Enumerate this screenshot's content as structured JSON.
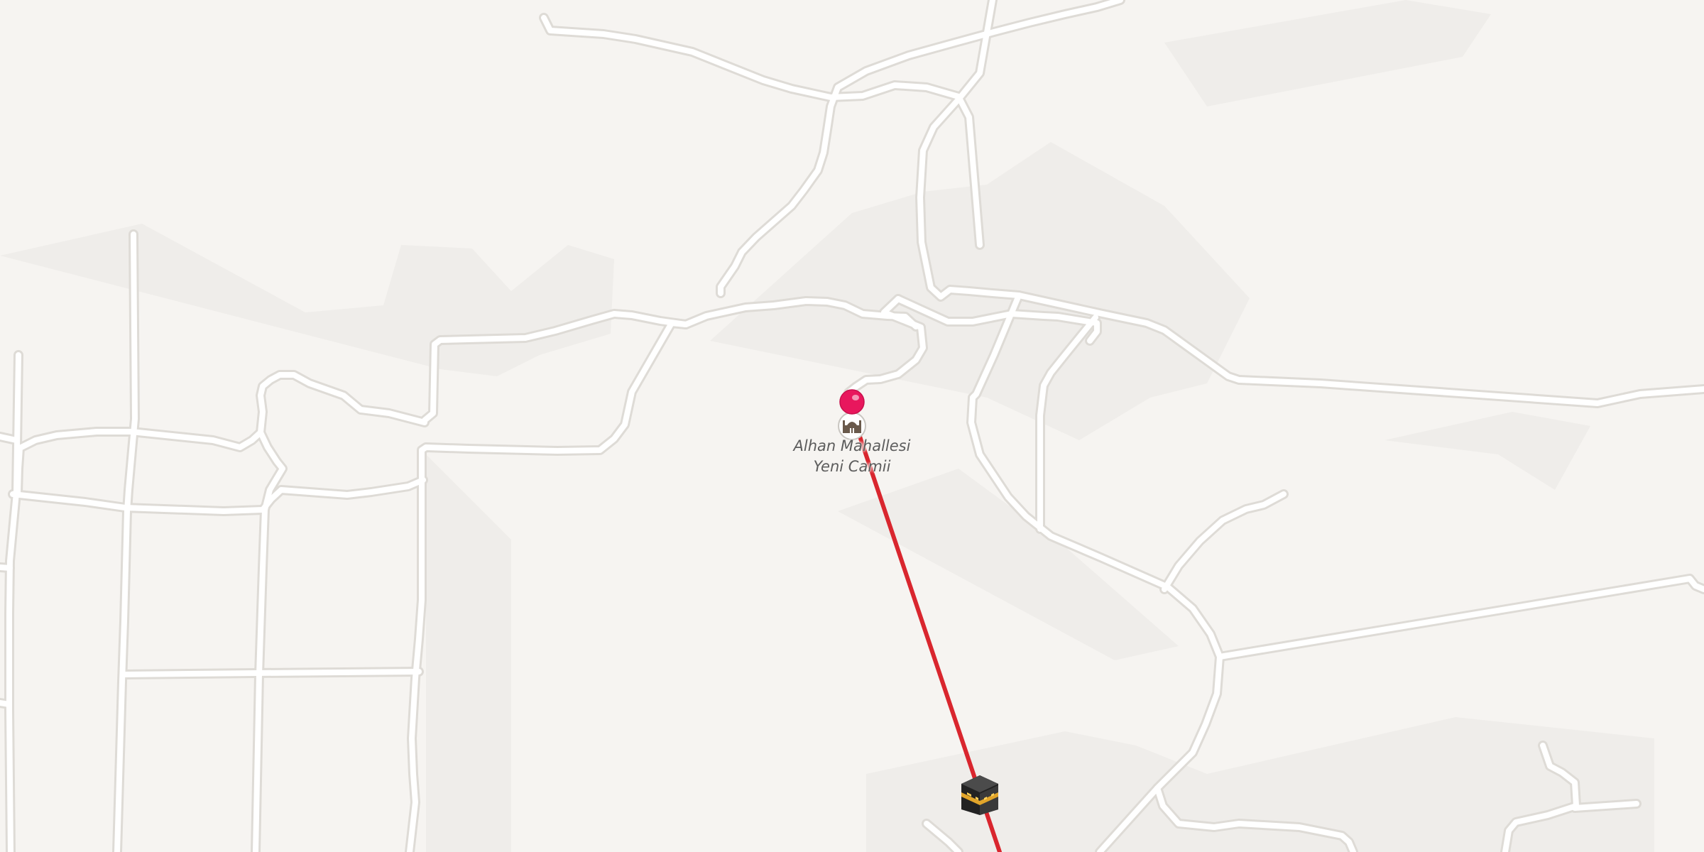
{
  "map": {
    "colors": {
      "background": "#f6f4f1",
      "terrain_shade": "#efedea",
      "road_fill": "#ffffff",
      "road_casing": "#dedbd6",
      "route_line": "#d9262e",
      "pin": "#e8175d"
    },
    "poi": {
      "name_line1": "Alhan Mahallesi",
      "name_line2": "Yeni Camii",
      "icon": "mosque-icon"
    },
    "selected_pin": {
      "icon": "map-pin-icon"
    },
    "qibla_marker": {
      "icon": "kaaba-icon"
    },
    "qibla_line": {
      "icon": "route-line"
    }
  }
}
